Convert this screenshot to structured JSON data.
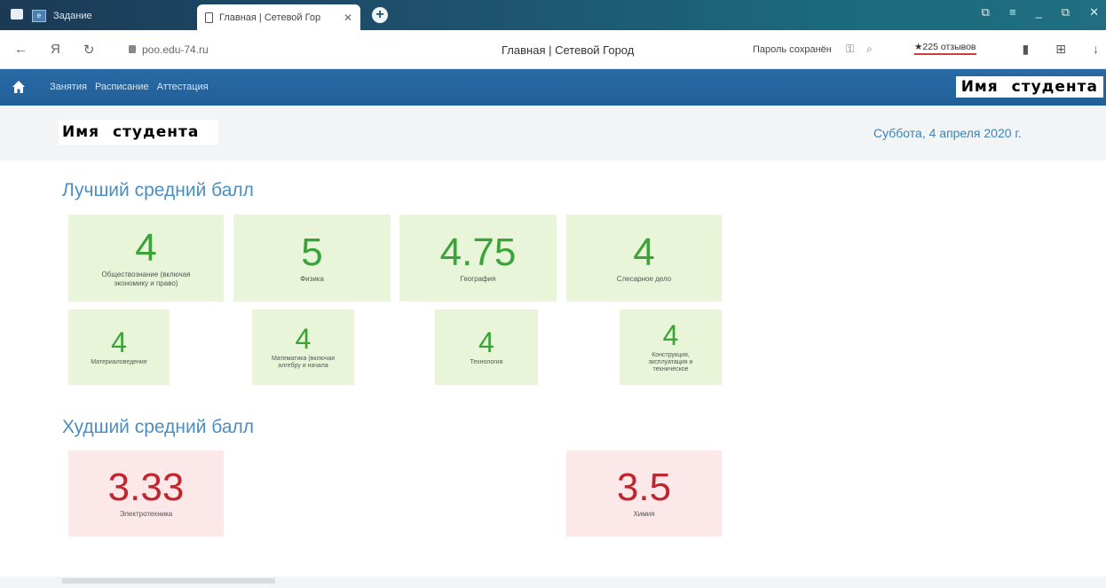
{
  "browser": {
    "tabs": [
      {
        "label": "Задание",
        "icon": "app-favicon-icon"
      },
      {
        "label": "Главная | Сетевой Гор",
        "icon": "document-icon",
        "active": true
      }
    ],
    "new_tab": "+",
    "address": {
      "url": "poo.edu-74.ru",
      "page_title": "Главная | Сетевой Город",
      "password_saved": "Пароль сохранён",
      "reviews": "★225 отзывов"
    }
  },
  "nav": {
    "links": [
      "Занятия",
      "Расписание",
      "Аттестация"
    ],
    "student": "Имя студента"
  },
  "header": {
    "student_name": "Имя студента",
    "date": "Суббота, 4 апреля 2020 г."
  },
  "best": {
    "title": "Лучший средний балл",
    "cards": [
      {
        "value": "4",
        "subject": "Обществознание (включая экономику и право)"
      },
      {
        "value": "5",
        "subject": "Физика"
      },
      {
        "value": "4.75",
        "subject": "География"
      },
      {
        "value": "4",
        "subject": "Слесарное дело"
      },
      {
        "value": "4",
        "subject": "Материаловедение"
      },
      {
        "value": "4",
        "subject": "Математика (включая алгебру и начала"
      },
      {
        "value": "4",
        "subject": "Технология"
      },
      {
        "value": "4",
        "subject": "Конструкция, эксплуатация и техническое"
      }
    ]
  },
  "worst": {
    "title": "Худший средний балл",
    "cards": [
      {
        "value": "3.33",
        "subject": "Электротехника"
      },
      {
        "value": "3.5",
        "subject": "Химия"
      }
    ]
  },
  "colors": {
    "nav_bg": "#215f98",
    "good_bg": "#e8f5d8",
    "good_text": "#3aa33a",
    "bad_bg": "#fce7e9",
    "bad_text": "#c0262e",
    "accent": "#4b8fc0"
  }
}
